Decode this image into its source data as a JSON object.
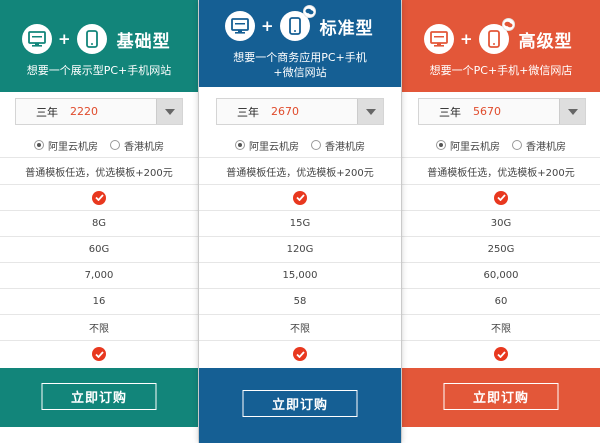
{
  "colors": {
    "basic": "#12857a",
    "standard": "#155f94",
    "advanced": "#e35739",
    "check": "#e8381f",
    "price": "#e04b2c"
  },
  "plans": [
    {
      "title": "基础型",
      "subtitle": "想要一个展示型PC+手机网站",
      "subtitle2": "",
      "year": "三年",
      "price": "2220",
      "radio1": "阿里云机房",
      "radio2": "香港机房",
      "template": "普通模板任选，优选模板+200元",
      "space": "8G",
      "traffic": "60G",
      "visits": "7,000",
      "pages": "16",
      "limit": "不限",
      "order": "立即订购"
    },
    {
      "title": "标准型",
      "subtitle": "想要一个商务应用PC+手机",
      "subtitle2": "+微信网站",
      "year": "三年",
      "price": "2670",
      "radio1": "阿里云机房",
      "radio2": "香港机房",
      "template": "普通模板任选，优选模板+200元",
      "space": "15G",
      "traffic": "120G",
      "visits": "15,000",
      "pages": "58",
      "limit": "不限",
      "order": "立即订购"
    },
    {
      "title": "高级型",
      "subtitle": "想要一个PC+手机+微信网店",
      "subtitle2": "",
      "year": "三年",
      "price": "5670",
      "radio1": "阿里云机房",
      "radio2": "香港机房",
      "template": "普通模板任选，优选模板+200元",
      "space": "30G",
      "traffic": "250G",
      "visits": "60,000",
      "pages": "60",
      "limit": "不限",
      "order": "立即订购"
    }
  ]
}
